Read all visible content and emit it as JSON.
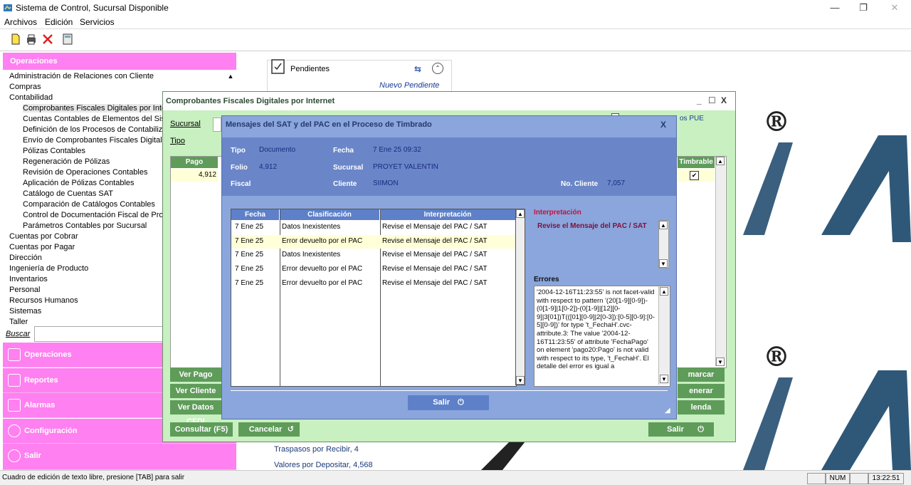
{
  "window": {
    "title": "Sistema de Control, Sucursal Disponible"
  },
  "menu": {
    "items": [
      "Archivos",
      "Edición",
      "Servicios"
    ]
  },
  "left": {
    "header": "Operaciones",
    "tree": [
      {
        "label": "Administración de Relaciones con Cliente",
        "level": 0
      },
      {
        "label": "Compras",
        "level": 0
      },
      {
        "label": "Contabilidad",
        "level": 0
      },
      {
        "label": "Comprobantes Fiscales Digitales por Internet",
        "level": 1,
        "selected": true
      },
      {
        "label": "Cuentas Contables de Elementos del Sistema",
        "level": 1
      },
      {
        "label": "Definición de los Procesos de Contabilización",
        "level": 1
      },
      {
        "label": "Envío de Comprobantes Fiscales Digitales",
        "level": 1
      },
      {
        "label": "Pólizas Contables",
        "level": 1
      },
      {
        "label": "Regeneración de Pólizas",
        "level": 1
      },
      {
        "label": "Revisión de Operaciones Contables",
        "level": 1
      },
      {
        "label": "Aplicación de Pólizas Contables",
        "level": 1
      },
      {
        "label": "Catálogo de Cuentas SAT",
        "level": 1
      },
      {
        "label": "Comparación de Catálogos Contables",
        "level": 1
      },
      {
        "label": "Control de Documentación Fiscal de Proveedores",
        "level": 1
      },
      {
        "label": "Parámetros Contables por Sucursal",
        "level": 1
      },
      {
        "label": "Cuentas por Cobrar",
        "level": 0
      },
      {
        "label": "Cuentas por Pagar",
        "level": 0
      },
      {
        "label": "Dirección",
        "level": 0
      },
      {
        "label": "Ingeniería de Producto",
        "level": 0
      },
      {
        "label": "Inventarios",
        "level": 0
      },
      {
        "label": "Personal",
        "level": 0
      },
      {
        "label": "Recursos Humanos",
        "level": 0
      },
      {
        "label": "Sistemas",
        "level": 0
      },
      {
        "label": "Taller",
        "level": 0
      }
    ],
    "search_label": "Buscar",
    "nav": [
      "Operaciones",
      "Reportes",
      "Alarmas",
      "Configuración",
      "Salir"
    ]
  },
  "background": {
    "pendientes": "Pendientes",
    "nuevo_pendiente": "Nuevo Pendiente",
    "traspasos": "Traspasos por Recibir, 4",
    "valores": "Valores por Depositar, 4,568",
    "registered": "®"
  },
  "cfdi": {
    "title": "Comprobantes Fiscales Digitales por Internet",
    "sucursal_label": "Sucursal",
    "tipo_label": "Tipo",
    "pue_label": "os PUE",
    "col_pago": "Pago",
    "col_timbrable": "Timbrable",
    "pago_value": "4,912",
    "buttons_left": [
      "Ver Pago",
      "Ver Cliente",
      "Ver Datos CFDI"
    ],
    "buttons_right": [
      "marcar",
      "enerar",
      "lenda"
    ],
    "consultar": "Consultar (F5)",
    "cancelar": "Cancelar",
    "salir": "Salir"
  },
  "sat": {
    "title": "Mensajes del SAT y del PAC en el Proceso de Timbrado",
    "close": "X",
    "labels": {
      "tipo": "Tipo",
      "fecha": "Fecha",
      "folio": "Folio",
      "sucursal": "Sucursal",
      "fiscal": "Fiscal",
      "cliente": "Cliente",
      "no_cliente": "No. Cliente"
    },
    "values": {
      "tipo": "Documento",
      "fecha": "7 Ene 25 09:32",
      "folio": "4,912",
      "sucursal": "PROYET VALENTIN",
      "cliente": "SIIMON",
      "no_cliente": "7,057"
    },
    "columns": [
      "Fecha",
      "Clasificación",
      "Interpretación"
    ],
    "rows": [
      {
        "fecha": "7 Ene 25",
        "clasificacion": "Datos Inexistentes",
        "interpretacion": "Revise el Mensaje del PAC / SAT"
      },
      {
        "fecha": "7 Ene 25",
        "clasificacion": "Error devuelto por el PAC",
        "interpretacion": "Revise el Mensaje del PAC / SAT"
      },
      {
        "fecha": "7 Ene 25",
        "clasificacion": "Datos Inexistentes",
        "interpretacion": "Revise el Mensaje del PAC / SAT"
      },
      {
        "fecha": "7 Ene 25",
        "clasificacion": "Error devuelto por el PAC",
        "interpretacion": "Revise el Mensaje del PAC / SAT"
      },
      {
        "fecha": "7 Ene 25",
        "clasificacion": "Error devuelto por el PAC",
        "interpretacion": "Revise el Mensaje del PAC / SAT"
      }
    ],
    "interpretacion_title": "Interpretación",
    "interpretacion_text": "Revise el Mensaje del PAC / SAT",
    "errores_title": "Errores",
    "errores_text": "'2004-12-16T11:23:55' is not facet-valid with respect to pattern '(20[1-9][0-9])-(0[1-9]|1[0-2])-(0[1-9]|[12][0-9]|3[01])T(([01][0-9]|2[0-3]):[0-5][0-9]:[0-5][0-9])' for type 't_FechaH'.cvc-attribute.3: The value '2004-12-16T11:23:55' of attribute 'FechaPago' on element 'pago20:Pago' is not valid with respect to its type, 't_FechaH'. El detalle del error es igual a",
    "salir": "Salir"
  },
  "status": {
    "text": "Cuadro de edición de texto libre, presione [TAB] para salir",
    "num": "NUM",
    "time": "13:22:51"
  },
  "colors": {
    "accent_pink": "#ff80f0",
    "green": "#5f9c5a",
    "blue": "#8aa6dc"
  }
}
